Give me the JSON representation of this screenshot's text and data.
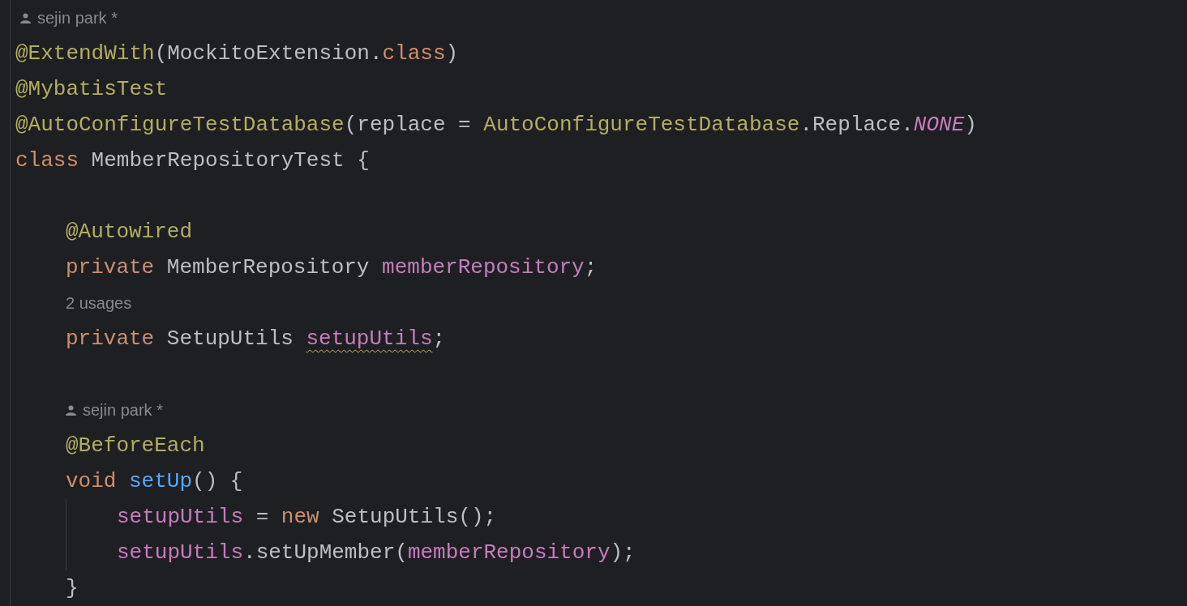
{
  "editor": {
    "lines": [
      {
        "kind": "author",
        "text": "sejin park *"
      },
      {
        "kind": "code",
        "tokens": [
          {
            "text": "@ExtendWith",
            "kind": "annotation"
          },
          {
            "text": "(MockitoExtension.",
            "kind": "plain"
          },
          {
            "text": "class",
            "kind": "keyword"
          },
          {
            "text": ")",
            "kind": "plain"
          }
        ]
      },
      {
        "kind": "code",
        "tokens": [
          {
            "text": "@MybatisTest",
            "kind": "annotation"
          }
        ]
      },
      {
        "kind": "code",
        "tokens": [
          {
            "text": "@AutoConfigureTestDatabase",
            "kind": "annotation"
          },
          {
            "text": "(replace = ",
            "kind": "plain"
          },
          {
            "text": "AutoConfigureTestDatabase",
            "kind": "annotation"
          },
          {
            "text": ".Replace.",
            "kind": "plain"
          },
          {
            "text": "NONE",
            "kind": "constant"
          },
          {
            "text": ")",
            "kind": "plain"
          }
        ]
      },
      {
        "kind": "code",
        "tokens": [
          {
            "text": "class",
            "kind": "keyword"
          },
          {
            "text": " MemberRepositoryTest {",
            "kind": "plain"
          }
        ],
        "children": [
          {
            "kind": "blank"
          },
          {
            "kind": "code",
            "tokens": [
              {
                "text": "@Autowired",
                "kind": "annotation"
              }
            ]
          },
          {
            "kind": "code",
            "tokens": [
              {
                "text": "private",
                "kind": "keyword"
              },
              {
                "text": " MemberRepository ",
                "kind": "plain"
              },
              {
                "text": "memberRepository",
                "kind": "field"
              },
              {
                "text": ";",
                "kind": "plain"
              }
            ]
          },
          {
            "kind": "usages",
            "text": "2 usages"
          },
          {
            "kind": "code",
            "tokens": [
              {
                "text": "private",
                "kind": "keyword"
              },
              {
                "text": " SetupUtils ",
                "kind": "plain"
              },
              {
                "text": "setupUtils",
                "kind": "field",
                "warning": true
              },
              {
                "text": ";",
                "kind": "plain"
              }
            ]
          },
          {
            "kind": "blank"
          },
          {
            "kind": "author",
            "text": "sejin park *"
          },
          {
            "kind": "code",
            "tokens": [
              {
                "text": "@BeforeEach",
                "kind": "annotation"
              }
            ]
          },
          {
            "kind": "code",
            "tokens": [
              {
                "text": "void ",
                "kind": "keyword"
              },
              {
                "text": "setUp",
                "kind": "method"
              },
              {
                "text": "() {",
                "kind": "plain"
              }
            ],
            "children": [
              {
                "kind": "code",
                "tokens": [
                  {
                    "text": "setupUtils",
                    "kind": "field"
                  },
                  {
                    "text": " = ",
                    "kind": "plain"
                  },
                  {
                    "text": "new",
                    "kind": "keyword"
                  },
                  {
                    "text": " SetupUtils();",
                    "kind": "plain"
                  }
                ]
              },
              {
                "kind": "code",
                "tokens": [
                  {
                    "text": "setupUtils",
                    "kind": "field"
                  },
                  {
                    "text": ".setUpMember(",
                    "kind": "plain"
                  },
                  {
                    "text": "memberRepository",
                    "kind": "field"
                  },
                  {
                    "text": ");",
                    "kind": "plain"
                  }
                ]
              }
            ]
          },
          {
            "kind": "code",
            "tokens": [
              {
                "text": "}",
                "kind": "plain"
              }
            ]
          }
        ]
      }
    ]
  }
}
